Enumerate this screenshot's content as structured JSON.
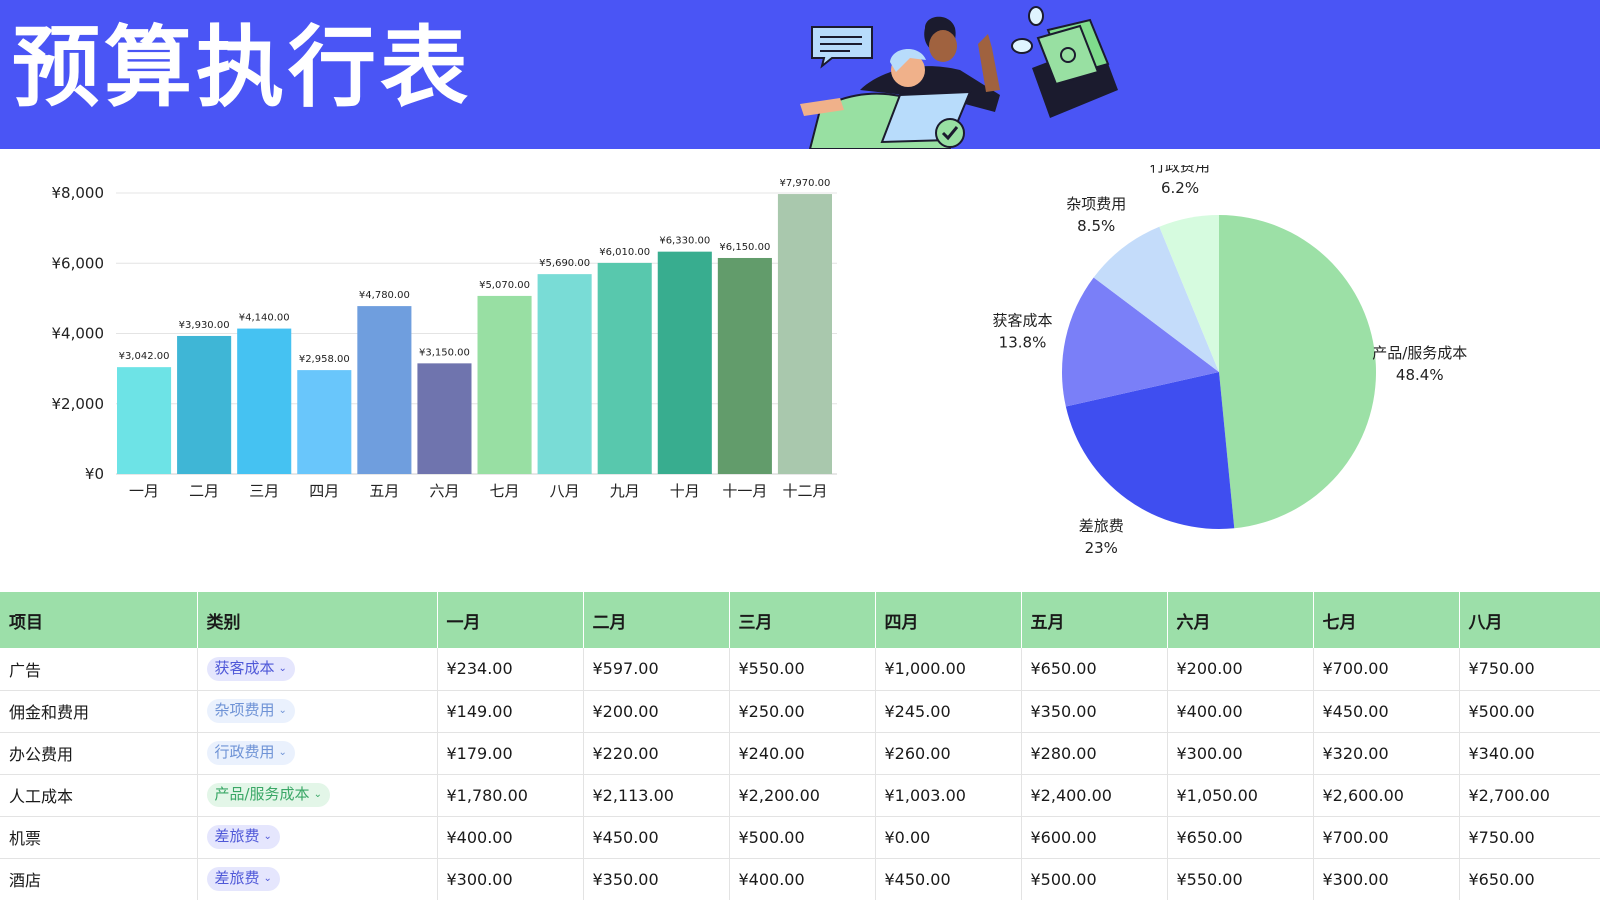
{
  "header": {
    "title": "预算执行表"
  },
  "colors": {
    "header_bg": "#4a55f5",
    "table_header_bg": "#9cdfa9",
    "bar_colors": [
      "#6de3e6",
      "#3fb6d6",
      "#45c2f2",
      "#69c6fb",
      "#6f9ede",
      "#6f74ae",
      "#98dfa3",
      "#79dcd6",
      "#58c8ad",
      "#38ad8f",
      "#629c6b",
      "#a9c8ad"
    ],
    "pie_colors": [
      "#9ce0a6",
      "#3f4ef0",
      "#7a7ff8",
      "#c4dcfa",
      "#d6fbdf"
    ]
  },
  "chart_data": [
    {
      "type": "bar",
      "categories": [
        "一月",
        "二月",
        "三月",
        "四月",
        "五月",
        "六月",
        "七月",
        "八月",
        "九月",
        "十月",
        "十一月",
        "十二月"
      ],
      "values": [
        3042,
        3930,
        4140,
        2958,
        4780,
        3150,
        5070,
        5690,
        6010,
        6330,
        6150,
        7970
      ],
      "value_labels": [
        "¥3,042.00",
        "¥3,930.00",
        "¥4,140.00",
        "¥2,958.00",
        "¥4,780.00",
        "¥3,150.00",
        "¥5,070.00",
        "¥5,690.00",
        "¥6,010.00",
        "¥6,330.00",
        "¥6,150.00",
        "¥7,970.00"
      ],
      "ylim": [
        0,
        8000
      ],
      "yticks": [
        0,
        2000,
        4000,
        6000,
        8000
      ],
      "ytick_labels": [
        "¥0",
        "¥2,000",
        "¥4,000",
        "¥6,000",
        "¥8,000"
      ],
      "grid": true,
      "title": "",
      "xlabel": "",
      "ylabel": ""
    },
    {
      "type": "pie",
      "slices": [
        {
          "label": "产品/服务成本",
          "value": 48.4,
          "pct_label": "48.4%"
        },
        {
          "label": "差旅费",
          "value": 23,
          "pct_label": "23%"
        },
        {
          "label": "获客成本",
          "value": 13.8,
          "pct_label": "13.8%"
        },
        {
          "label": "杂项费用",
          "value": 8.5,
          "pct_label": "8.5%"
        },
        {
          "label": "行政费用",
          "value": 6.2,
          "pct_label": "6.2%"
        }
      ],
      "title": ""
    }
  ],
  "table": {
    "headers": [
      "项目",
      "类别",
      "一月",
      "二月",
      "三月",
      "四月",
      "五月",
      "六月",
      "七月",
      "八月"
    ],
    "rows": [
      {
        "item": "广告",
        "category": "获客成本",
        "chip_bg": "#e5e6fd",
        "chip_fg": "#4f58d8",
        "values": [
          "¥234.00",
          "¥597.00",
          "¥550.00",
          "¥1,000.00",
          "¥650.00",
          "¥200.00",
          "¥700.00",
          "¥750.00"
        ]
      },
      {
        "item": "佣金和费用",
        "category": "杂项费用",
        "chip_bg": "#eaf1fd",
        "chip_fg": "#6f93d6",
        "values": [
          "¥149.00",
          "¥200.00",
          "¥250.00",
          "¥245.00",
          "¥350.00",
          "¥400.00",
          "¥450.00",
          "¥500.00"
        ]
      },
      {
        "item": "办公费用",
        "category": "行政费用",
        "chip_bg": "#eaf1fd",
        "chip_fg": "#6f93d6",
        "values": [
          "¥179.00",
          "¥220.00",
          "¥240.00",
          "¥260.00",
          "¥280.00",
          "¥300.00",
          "¥320.00",
          "¥340.00"
        ]
      },
      {
        "item": "人工成本",
        "category": "产品/服务成本",
        "chip_bg": "#e3f6e8",
        "chip_fg": "#3aa766",
        "values": [
          "¥1,780.00",
          "¥2,113.00",
          "¥2,200.00",
          "¥1,003.00",
          "¥2,400.00",
          "¥1,050.00",
          "¥2,600.00",
          "¥2,700.00"
        ]
      },
      {
        "item": "机票",
        "category": "差旅费",
        "chip_bg": "#e5e6fd",
        "chip_fg": "#4f58d8",
        "values": [
          "¥400.00",
          "¥450.00",
          "¥500.00",
          "¥0.00",
          "¥600.00",
          "¥650.00",
          "¥700.00",
          "¥750.00"
        ]
      },
      {
        "item": "酒店",
        "category": "差旅费",
        "chip_bg": "#e5e6fd",
        "chip_fg": "#4f58d8",
        "values": [
          "¥300.00",
          "¥350.00",
          "¥400.00",
          "¥450.00",
          "¥500.00",
          "¥550.00",
          "¥300.00",
          "¥650.00"
        ]
      }
    ]
  }
}
